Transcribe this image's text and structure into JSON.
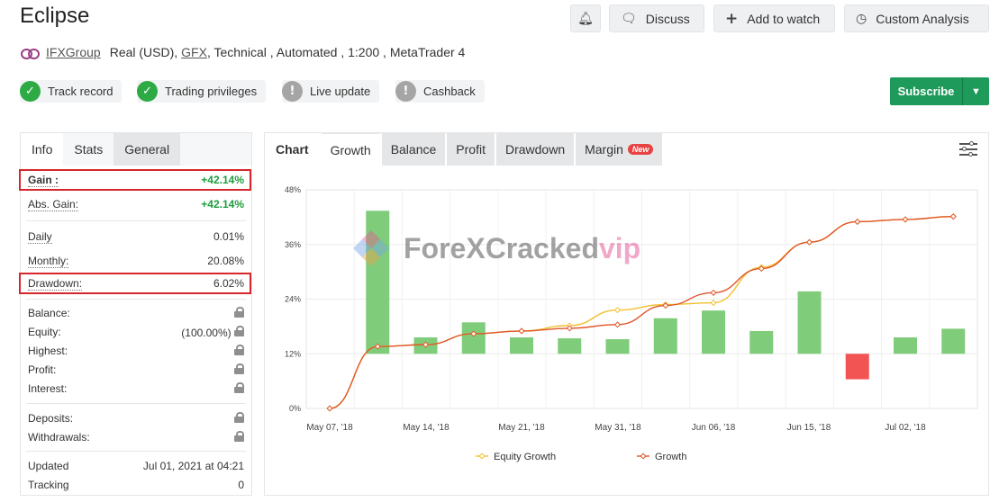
{
  "title": "Eclipse",
  "top_buttons": [
    {
      "label": ""
    },
    {
      "label": "Discuss"
    },
    {
      "label": "Add to watch"
    },
    {
      "label": "Custom Analysis"
    }
  ],
  "meta": {
    "broker": "IFXGroup",
    "account": "Real (USD),",
    "currency": "GFX",
    "details": ", Technical , Automated , 1:200 , MetaTrader 4"
  },
  "badges": [
    {
      "label": "Track record",
      "status": "ok"
    },
    {
      "label": "Trading privileges",
      "status": "ok"
    },
    {
      "label": "Live update",
      "status": "na"
    },
    {
      "label": "Cashback",
      "status": "na"
    }
  ],
  "subscribe_label": "Subscribe",
  "left_tabs": [
    "Info",
    "Stats",
    "General"
  ],
  "stats": {
    "gain": {
      "label": "Gain :",
      "value": "+42.14%"
    },
    "abs_gain": {
      "label": "Abs. Gain:",
      "value": "+42.14%"
    },
    "daily": {
      "label": "Daily",
      "value": "0.01%"
    },
    "monthly": {
      "label": "Monthly:",
      "value": "20.08%"
    },
    "drawdown": {
      "label": "Drawdown:",
      "value": "6.02%"
    },
    "balance": {
      "label": "Balance:"
    },
    "equity": {
      "label": "Equity:",
      "value": "(100.00%)"
    },
    "highest": {
      "label": "Highest:"
    },
    "profit": {
      "label": "Profit:"
    },
    "interest": {
      "label": "Interest:"
    },
    "deposits": {
      "label": "Deposits:"
    },
    "withdrawals": {
      "label": "Withdrawals:"
    },
    "updated": {
      "label": "Updated",
      "value": "Jul 01, 2021 at 04:21"
    },
    "tracking": {
      "label": "Tracking",
      "value": "0"
    }
  },
  "chart_tabs": {
    "label": "Chart",
    "items": [
      "Growth",
      "Balance",
      "Profit",
      "Drawdown",
      "Margin"
    ],
    "new_badge": "New"
  },
  "watermark": {
    "text1": "ForeXCracked",
    "text2": "vip"
  },
  "chart_data": {
    "type": "line",
    "y_ticks": [
      "0%",
      "12%",
      "24%",
      "36%",
      "48%"
    ],
    "ylim": [
      0,
      48
    ],
    "x_tick_labels": [
      "May 07, '18",
      "May 14, '18",
      "May 21, '18",
      "May 31, '18",
      "Jun 06, '18",
      "Jun 15, '18",
      "Jul 02, '18"
    ],
    "series": [
      {
        "name": "Equity Growth",
        "color": "#f2c02e",
        "values": [
          0,
          13.6,
          14,
          16.4,
          17,
          18.2,
          21.6,
          22.8,
          23.2,
          31,
          36.5,
          41,
          41.5,
          42.14
        ]
      },
      {
        "name": "Growth",
        "color": "#e0562a",
        "values": [
          0,
          13.6,
          14,
          16.4,
          17,
          17.6,
          18.4,
          22.6,
          25.4,
          30.7,
          36.5,
          41,
          41.5,
          42.14
        ]
      }
    ],
    "bars": {
      "baseline": 12,
      "values": [
        43.4,
        15.6,
        18.9,
        15.6,
        15.4,
        15.2,
        19.8,
        21.5,
        17,
        25.7,
        6.4,
        15.6,
        17.5
      ],
      "colors": {
        "positive": "#7fcc7a",
        "negative": "#f25454"
      }
    }
  }
}
